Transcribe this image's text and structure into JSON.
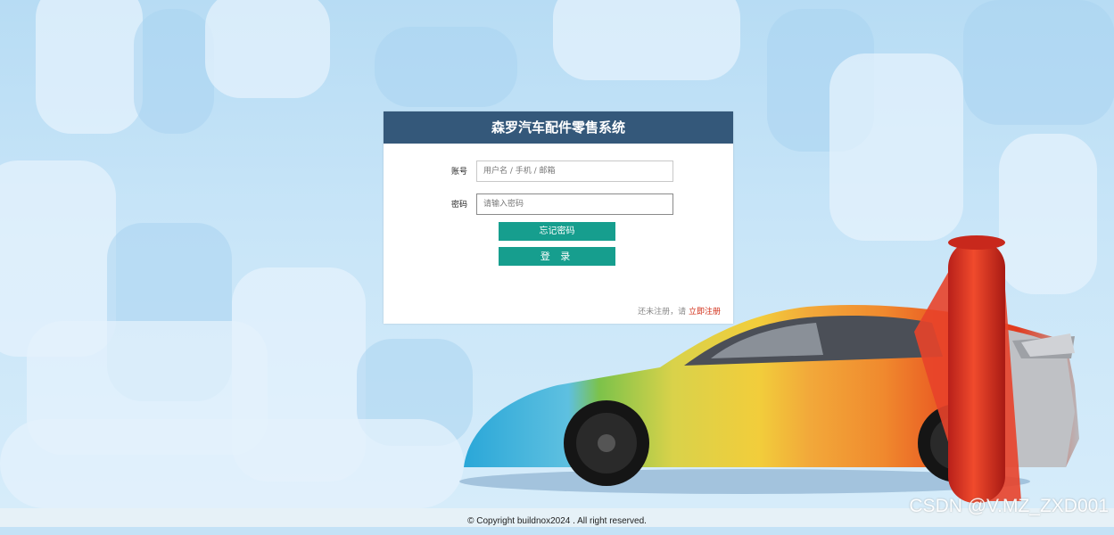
{
  "login": {
    "title": "森罗汽车配件零售系统",
    "account_label": "账号",
    "account_placeholder": "用户名 / 手机 / 邮箱",
    "password_label": "密码",
    "password_placeholder": "请输入密码",
    "forgot_label": "忘记密码",
    "login_label": "登 录",
    "register_prompt": "还未注册，请",
    "register_link": "立即注册"
  },
  "footer": {
    "copyright": "© Copyright buildnox2024 . All right reserved."
  },
  "watermark": "CSDN @V.MZ_ZXD001",
  "colors": {
    "header_bg": "#34587a",
    "button_bg": "#169e8e",
    "register_link": "#d22d16"
  }
}
